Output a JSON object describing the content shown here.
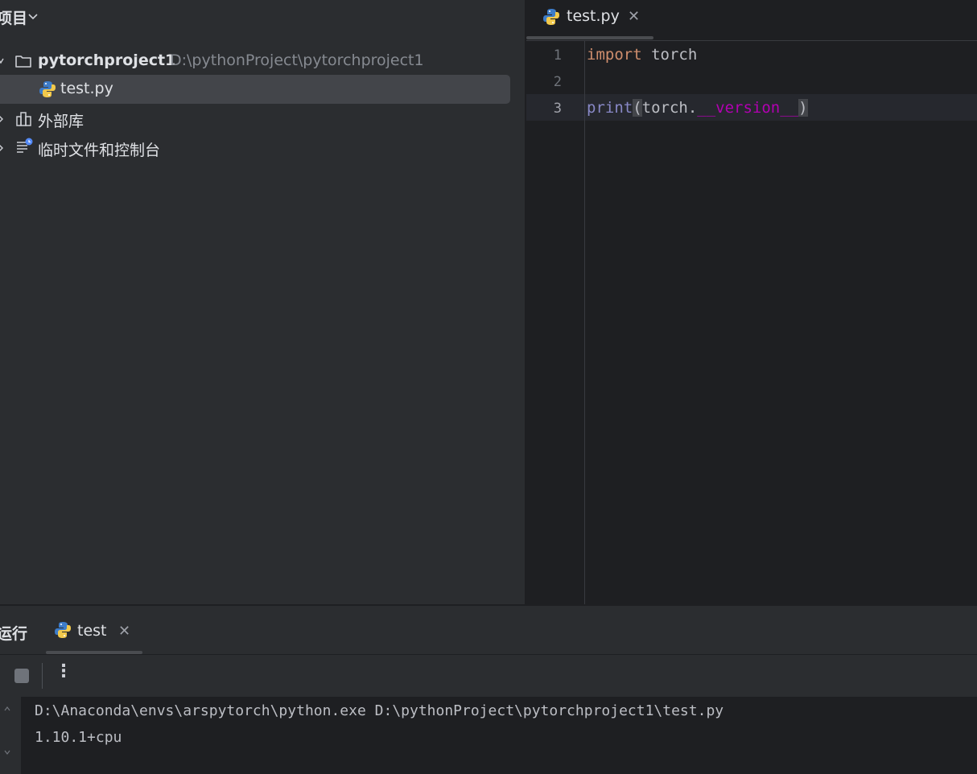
{
  "project_panel": {
    "title": "项目",
    "tree": {
      "root": {
        "name": "pytorchproject1",
        "path": "D:\\pythonProject\\pytorchproject1"
      },
      "file": {
        "name": "test.py"
      },
      "external": {
        "label": "外部库"
      },
      "scratches": {
        "label": "临时文件和控制台"
      }
    }
  },
  "editor": {
    "tab": {
      "label": "test.py"
    },
    "line_numbers": [
      "1",
      "2",
      "3"
    ],
    "code": {
      "line1": {
        "keyword": "import",
        "rest": " torch"
      },
      "line3": {
        "func": "print",
        "open": "(",
        "obj": "torch.",
        "attr": "__version__",
        "close": ")"
      }
    }
  },
  "run_panel": {
    "title": "运行",
    "tab": {
      "label": "test"
    },
    "console": [
      "D:\\Anaconda\\envs\\arspytorch\\python.exe D:\\pythonProject\\pytorchproject1\\test.py",
      "1.10.1+cpu"
    ]
  },
  "colors": {
    "background": "#2b2d30",
    "editor_background": "#1e1f22",
    "selection": "#43454a",
    "keyword": "#cf8e6d",
    "builtin": "#8888c6",
    "dunder": "#b200b2"
  }
}
